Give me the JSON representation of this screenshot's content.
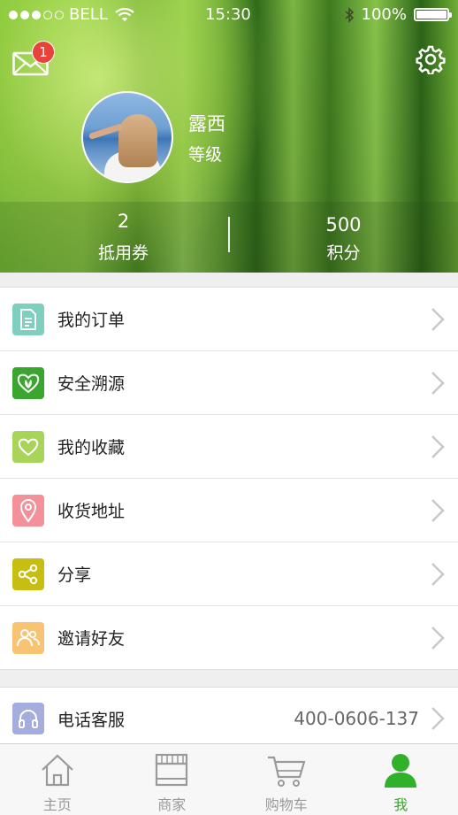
{
  "status_bar": {
    "carrier": "BELL",
    "time": "15:30",
    "battery": "100%"
  },
  "header": {
    "mail_badge": "1",
    "username": "露西",
    "level_label": "等级",
    "stats": [
      {
        "value": "2",
        "label": "抵用券"
      },
      {
        "value": "500",
        "label": "积分"
      }
    ]
  },
  "menu": [
    {
      "label": "我的订单",
      "icon": "document-icon",
      "color": "#7fcfc0"
    },
    {
      "label": "安全溯源",
      "icon": "leaf-heart-icon",
      "color": "#3aa62f"
    },
    {
      "label": "我的收藏",
      "icon": "heart-icon",
      "color": "#a9d45a"
    },
    {
      "label": "收货地址",
      "icon": "location-pin-icon",
      "color": "#f3909a"
    },
    {
      "label": "分享",
      "icon": "share-icon",
      "color": "#c8be12"
    },
    {
      "label": "邀请好友",
      "icon": "invite-friends-icon",
      "color": "#f8c474"
    }
  ],
  "service": {
    "label": "电话客服",
    "phone": "400-0606-137",
    "icon": "headphones-icon",
    "color": "#a5addf"
  },
  "tabbar": {
    "active_color": "#3aa62f",
    "tabs": [
      {
        "label": "主页",
        "icon": "home-icon"
      },
      {
        "label": "商家",
        "icon": "store-icon"
      },
      {
        "label": "购物车",
        "icon": "cart-icon"
      },
      {
        "label": "我",
        "icon": "profile-icon"
      }
    ]
  }
}
